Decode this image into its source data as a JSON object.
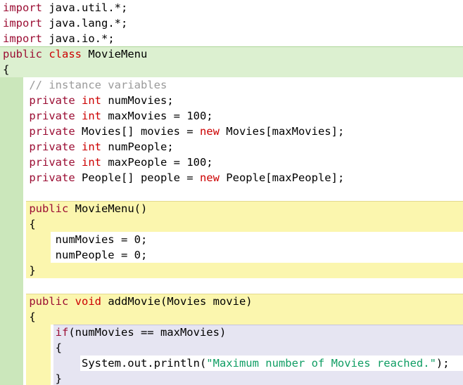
{
  "editor": {
    "language": "java",
    "class_name": "MovieMenu",
    "colors": {
      "keyword1": "#9b0d33",
      "keyword2": "#cc0000",
      "string": "#0f9d63",
      "comment": "#9a9a9a",
      "plain": "#000000",
      "scope_class": "#dcf0d0",
      "scope_class_strip": "#cbe7bb",
      "scope_method": "#fbf6ae",
      "scope_selection": "#e6e5f2",
      "edge_class": "#aed69a",
      "edge_method": "#e3da8e",
      "edge_if": "#c6c4de"
    },
    "lines": [
      {
        "bg": "plain",
        "segments": [
          {
            "t": "import",
            "c": "kw1"
          },
          {
            "t": " java.util.*;",
            "c": "plain"
          }
        ]
      },
      {
        "bg": "plain",
        "segments": [
          {
            "t": "import",
            "c": "kw1"
          },
          {
            "t": " java.lang.*;",
            "c": "plain"
          }
        ]
      },
      {
        "bg": "plain",
        "segments": [
          {
            "t": "import",
            "c": "kw1"
          },
          {
            "t": " java.io.*;",
            "c": "plain"
          }
        ]
      },
      {
        "bg": "class-hdr",
        "edge": "class",
        "segments": [
          {
            "t": "public",
            "c": "kw1"
          },
          {
            "t": " ",
            "c": "plain"
          },
          {
            "t": "class",
            "c": "kw2"
          },
          {
            "t": " MovieMenu",
            "c": "plain"
          }
        ]
      },
      {
        "bg": "class-hdr",
        "segments": [
          {
            "t": "{",
            "c": "plain"
          }
        ]
      },
      {
        "bg": "class-body",
        "segments": [
          {
            "t": "    // instance variables",
            "c": "com"
          }
        ]
      },
      {
        "bg": "class-body",
        "segments": [
          {
            "t": "    ",
            "c": "plain"
          },
          {
            "t": "private",
            "c": "kw1"
          },
          {
            "t": " ",
            "c": "plain"
          },
          {
            "t": "int",
            "c": "kw2"
          },
          {
            "t": " numMovies;",
            "c": "plain"
          }
        ]
      },
      {
        "bg": "class-body",
        "segments": [
          {
            "t": "    ",
            "c": "plain"
          },
          {
            "t": "private",
            "c": "kw1"
          },
          {
            "t": " ",
            "c": "plain"
          },
          {
            "t": "int",
            "c": "kw2"
          },
          {
            "t": " maxMovies = 100;",
            "c": "plain"
          }
        ]
      },
      {
        "bg": "class-body",
        "segments": [
          {
            "t": "    ",
            "c": "plain"
          },
          {
            "t": "private",
            "c": "kw1"
          },
          {
            "t": " Movies[] movies = ",
            "c": "plain"
          },
          {
            "t": "new",
            "c": "kw2"
          },
          {
            "t": " Movies[maxMovies];",
            "c": "plain"
          }
        ]
      },
      {
        "bg": "class-body",
        "segments": [
          {
            "t": "    ",
            "c": "plain"
          },
          {
            "t": "private",
            "c": "kw1"
          },
          {
            "t": " ",
            "c": "plain"
          },
          {
            "t": "int",
            "c": "kw2"
          },
          {
            "t": " numPeople;",
            "c": "plain"
          }
        ]
      },
      {
        "bg": "class-body",
        "segments": [
          {
            "t": "    ",
            "c": "plain"
          },
          {
            "t": "private",
            "c": "kw1"
          },
          {
            "t": " ",
            "c": "plain"
          },
          {
            "t": "int",
            "c": "kw2"
          },
          {
            "t": " maxPeople = 100;",
            "c": "plain"
          }
        ]
      },
      {
        "bg": "class-body",
        "segments": [
          {
            "t": "    ",
            "c": "plain"
          },
          {
            "t": "private",
            "c": "kw1"
          },
          {
            "t": " People[] people = ",
            "c": "plain"
          },
          {
            "t": "new",
            "c": "kw2"
          },
          {
            "t": " People[maxPeople];",
            "c": "plain"
          }
        ]
      },
      {
        "bg": "class-body",
        "segments": []
      },
      {
        "bg": "method-hdr",
        "edge": "method",
        "segments": [
          {
            "t": "    ",
            "c": "plain"
          },
          {
            "t": "public",
            "c": "kw1"
          },
          {
            "t": " MovieMenu()",
            "c": "plain"
          }
        ]
      },
      {
        "bg": "method-hdr",
        "segments": [
          {
            "t": "    {",
            "c": "plain"
          }
        ]
      },
      {
        "bg": "method-int",
        "segments": [
          {
            "t": "        numMovies = 0;",
            "c": "plain"
          }
        ]
      },
      {
        "bg": "method-int",
        "segments": [
          {
            "t": "        numPeople = 0;",
            "c": "plain"
          }
        ]
      },
      {
        "bg": "method-hdr",
        "segments": [
          {
            "t": "    }",
            "c": "plain"
          }
        ]
      },
      {
        "bg": "class-body",
        "segments": []
      },
      {
        "bg": "method-hdr",
        "edge": "method",
        "segments": [
          {
            "t": "    ",
            "c": "plain"
          },
          {
            "t": "public",
            "c": "kw1"
          },
          {
            "t": " ",
            "c": "plain"
          },
          {
            "t": "void",
            "c": "kw2"
          },
          {
            "t": " addMovie(Movies movie)",
            "c": "plain"
          }
        ]
      },
      {
        "bg": "method-hdr",
        "segments": [
          {
            "t": "    {",
            "c": "plain"
          }
        ]
      },
      {
        "bg": "if-hdr",
        "edge": "if",
        "segments": [
          {
            "t": "        ",
            "c": "plain"
          },
          {
            "t": "if",
            "c": "kw1"
          },
          {
            "t": "(numMovies == maxMovies)",
            "c": "plain"
          }
        ]
      },
      {
        "bg": "if-hdr",
        "segments": [
          {
            "t": "        {",
            "c": "plain"
          }
        ]
      },
      {
        "bg": "if-int",
        "segments": [
          {
            "t": "            System.out.println(",
            "c": "plain"
          },
          {
            "t": "\"Maximum number of Movies reached.\"",
            "c": "str"
          },
          {
            "t": ");",
            "c": "plain"
          }
        ]
      },
      {
        "bg": "if-hdr",
        "segments": [
          {
            "t": "        }",
            "c": "plain"
          }
        ]
      }
    ]
  }
}
